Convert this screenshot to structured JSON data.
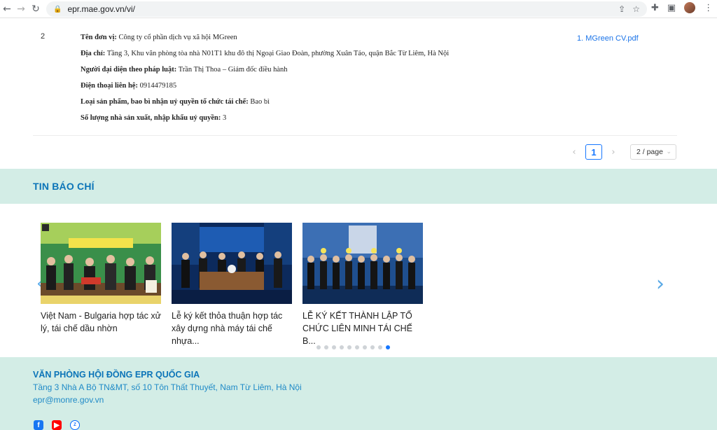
{
  "browser": {
    "url": "epr.mae.gov.vn/vi/"
  },
  "record": {
    "index": "2",
    "lines": [
      {
        "label": "Tên đơn vị:",
        "value": " Công ty cổ phần dịch vụ xã hội MGreen"
      },
      {
        "label": "Địa chỉ:",
        "value": " Tầng 3, Khu văn phòng tòa nhà N01T1 khu đô thị Ngoại Giao Đoàn, phường Xuân Tảo, quận Bắc Từ Liêm, Hà Nội"
      },
      {
        "label": "Người đại diện theo pháp luật:",
        "value": " Trần Thị Thoa – Giám đốc điều hành"
      },
      {
        "label": "Điện thoại liên hệ:",
        "value": " 0914479185"
      },
      {
        "label": "Loại sản phẩm, bao bì nhận uỷ quyền tổ chức tái chế:",
        "value": " Bao bì"
      },
      {
        "label": "Số lượng nhà sản xuất, nhập khẩu uỷ quyền:",
        "value": " 3"
      }
    ],
    "file_link": "1. MGreen CV.pdf"
  },
  "pagination": {
    "current_page": "1",
    "page_size": "2 / page"
  },
  "news": {
    "title": "TIN BÁO CHÍ",
    "cards": [
      {
        "caption": "Việt Nam - Bulgaria hợp tác xử lý, tái chế dầu nhờn"
      },
      {
        "caption": "Lễ ký kết thỏa thuận hợp tác xây dựng nhà máy tái chế nhựa..."
      },
      {
        "caption": "LỄ KÝ KẾT THÀNH LẬP TỔ CHỨC LIÊN MINH TÁI CHẾ B..."
      }
    ],
    "dots_total": 10,
    "dots_active_index": 9
  },
  "footer": {
    "title": "VĂN PHÒNG HỘI ĐỒNG EPR QUỐC GIA",
    "address": "Tầng 3 Nhà A Bộ TN&MT, số 10 Tôn Thất Thuyết, Nam Từ Liêm, Hà Nội",
    "email": "epr@monre.gov.vn",
    "social": [
      "facebook-icon",
      "youtube-icon",
      "zalo-icon"
    ]
  },
  "colors": {
    "accent": "#0b74b8",
    "band": "#d3ede6",
    "link": "#1a73e8",
    "pager_active": "#1677ff"
  }
}
